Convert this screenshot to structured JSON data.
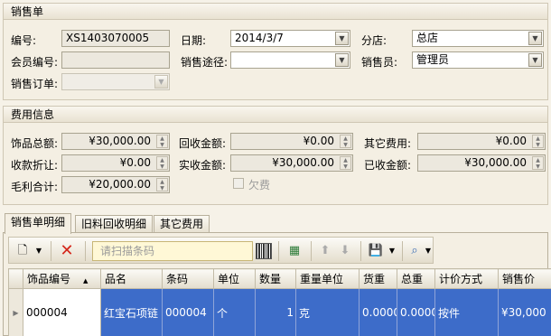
{
  "sales": {
    "title": "销售单",
    "number_label": "编号:",
    "number_value": "XS1403070005",
    "date_label": "日期:",
    "date_value": "2014/3/7",
    "store_label": "分店:",
    "store_value": "总店",
    "member_label": "会员编号:",
    "member_value": "",
    "channel_label": "销售途径:",
    "channel_value": "",
    "salesman_label": "销售员:",
    "salesman_value": "管理员",
    "order_label": "销售订单:",
    "order_value": ""
  },
  "fees": {
    "title": "费用信息",
    "jewelry_total_label": "饰品总额:",
    "jewelry_total_value": "¥30,000.00",
    "recycle_label": "回收金额:",
    "recycle_value": "¥0.00",
    "other_label": "其它费用:",
    "other_value": "¥0.00",
    "discount_label": "收款折让:",
    "discount_value": "¥0.00",
    "actual_label": "实收金额:",
    "actual_value": "¥30,000.00",
    "received_label": "已收金额:",
    "received_value": "¥30,000.00",
    "profit_label": "毛利合计:",
    "profit_value": "¥20,000.00",
    "owed_label": "欠费"
  },
  "tabs": [
    "销售单明细",
    "旧料回收明细",
    "其它费用"
  ],
  "toolbar": {
    "scan_placeholder": "请扫描条码"
  },
  "grid": {
    "columns": [
      "饰品编号",
      "品名",
      "条码",
      "单位",
      "数量",
      "重量单位",
      "货重",
      "总重",
      "计价方式",
      "销售价"
    ],
    "rows": [
      [
        "000004",
        "红宝石项链",
        "000004",
        "个",
        "1",
        "克",
        "0.0000",
        "0.0000",
        "按件",
        "¥30,000"
      ]
    ]
  },
  "colors": {
    "selected_row": "#3d6cc9",
    "scan_input_bg": "#fff8d6"
  }
}
